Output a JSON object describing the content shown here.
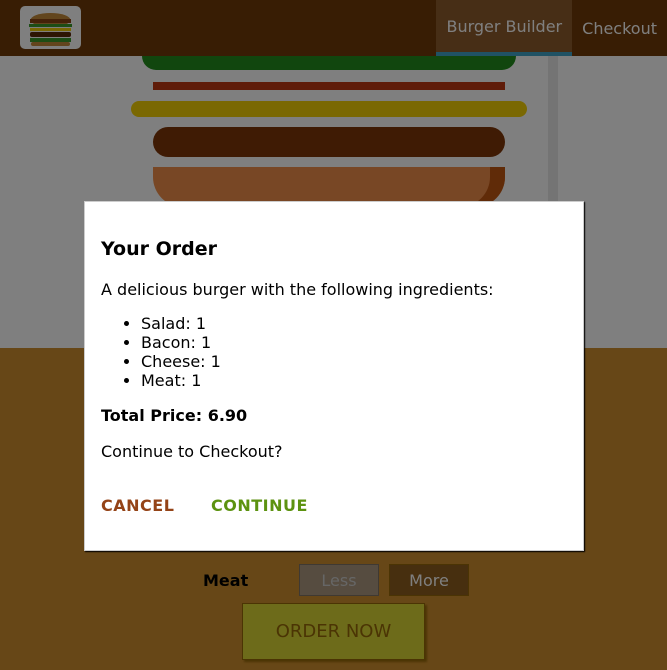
{
  "nav": {
    "logo_icon": "burger-logo",
    "items": [
      {
        "label": "Burger Builder",
        "active": true
      },
      {
        "label": "Checkout",
        "active": false
      }
    ]
  },
  "burger": {
    "layers": [
      "salad",
      "bacon",
      "cheese",
      "meat",
      "bread-bottom"
    ]
  },
  "controls": {
    "visible_control": {
      "label": "Meat",
      "less_label": "Less",
      "more_label": "More"
    },
    "order_button_label": "ORDER NOW"
  },
  "modal": {
    "title": "Your Order",
    "description": "A delicious burger with the following ingredients:",
    "ingredients": [
      {
        "text": "Salad: 1"
      },
      {
        "text": "Bacon: 1"
      },
      {
        "text": "Cheese: 1"
      },
      {
        "text": "Meat: 1"
      }
    ],
    "total_price": "Total Price: 6.90",
    "continue_question": "Continue to Checkout?",
    "cancel_label": "CANCEL",
    "continue_label": "CONTINUE"
  },
  "colors": {
    "toolbar": "#703B09",
    "controls_bg": "#CF8F2E",
    "cancel": "#944317",
    "continue": "#5C9210",
    "active_underline": "#40A4C8"
  }
}
